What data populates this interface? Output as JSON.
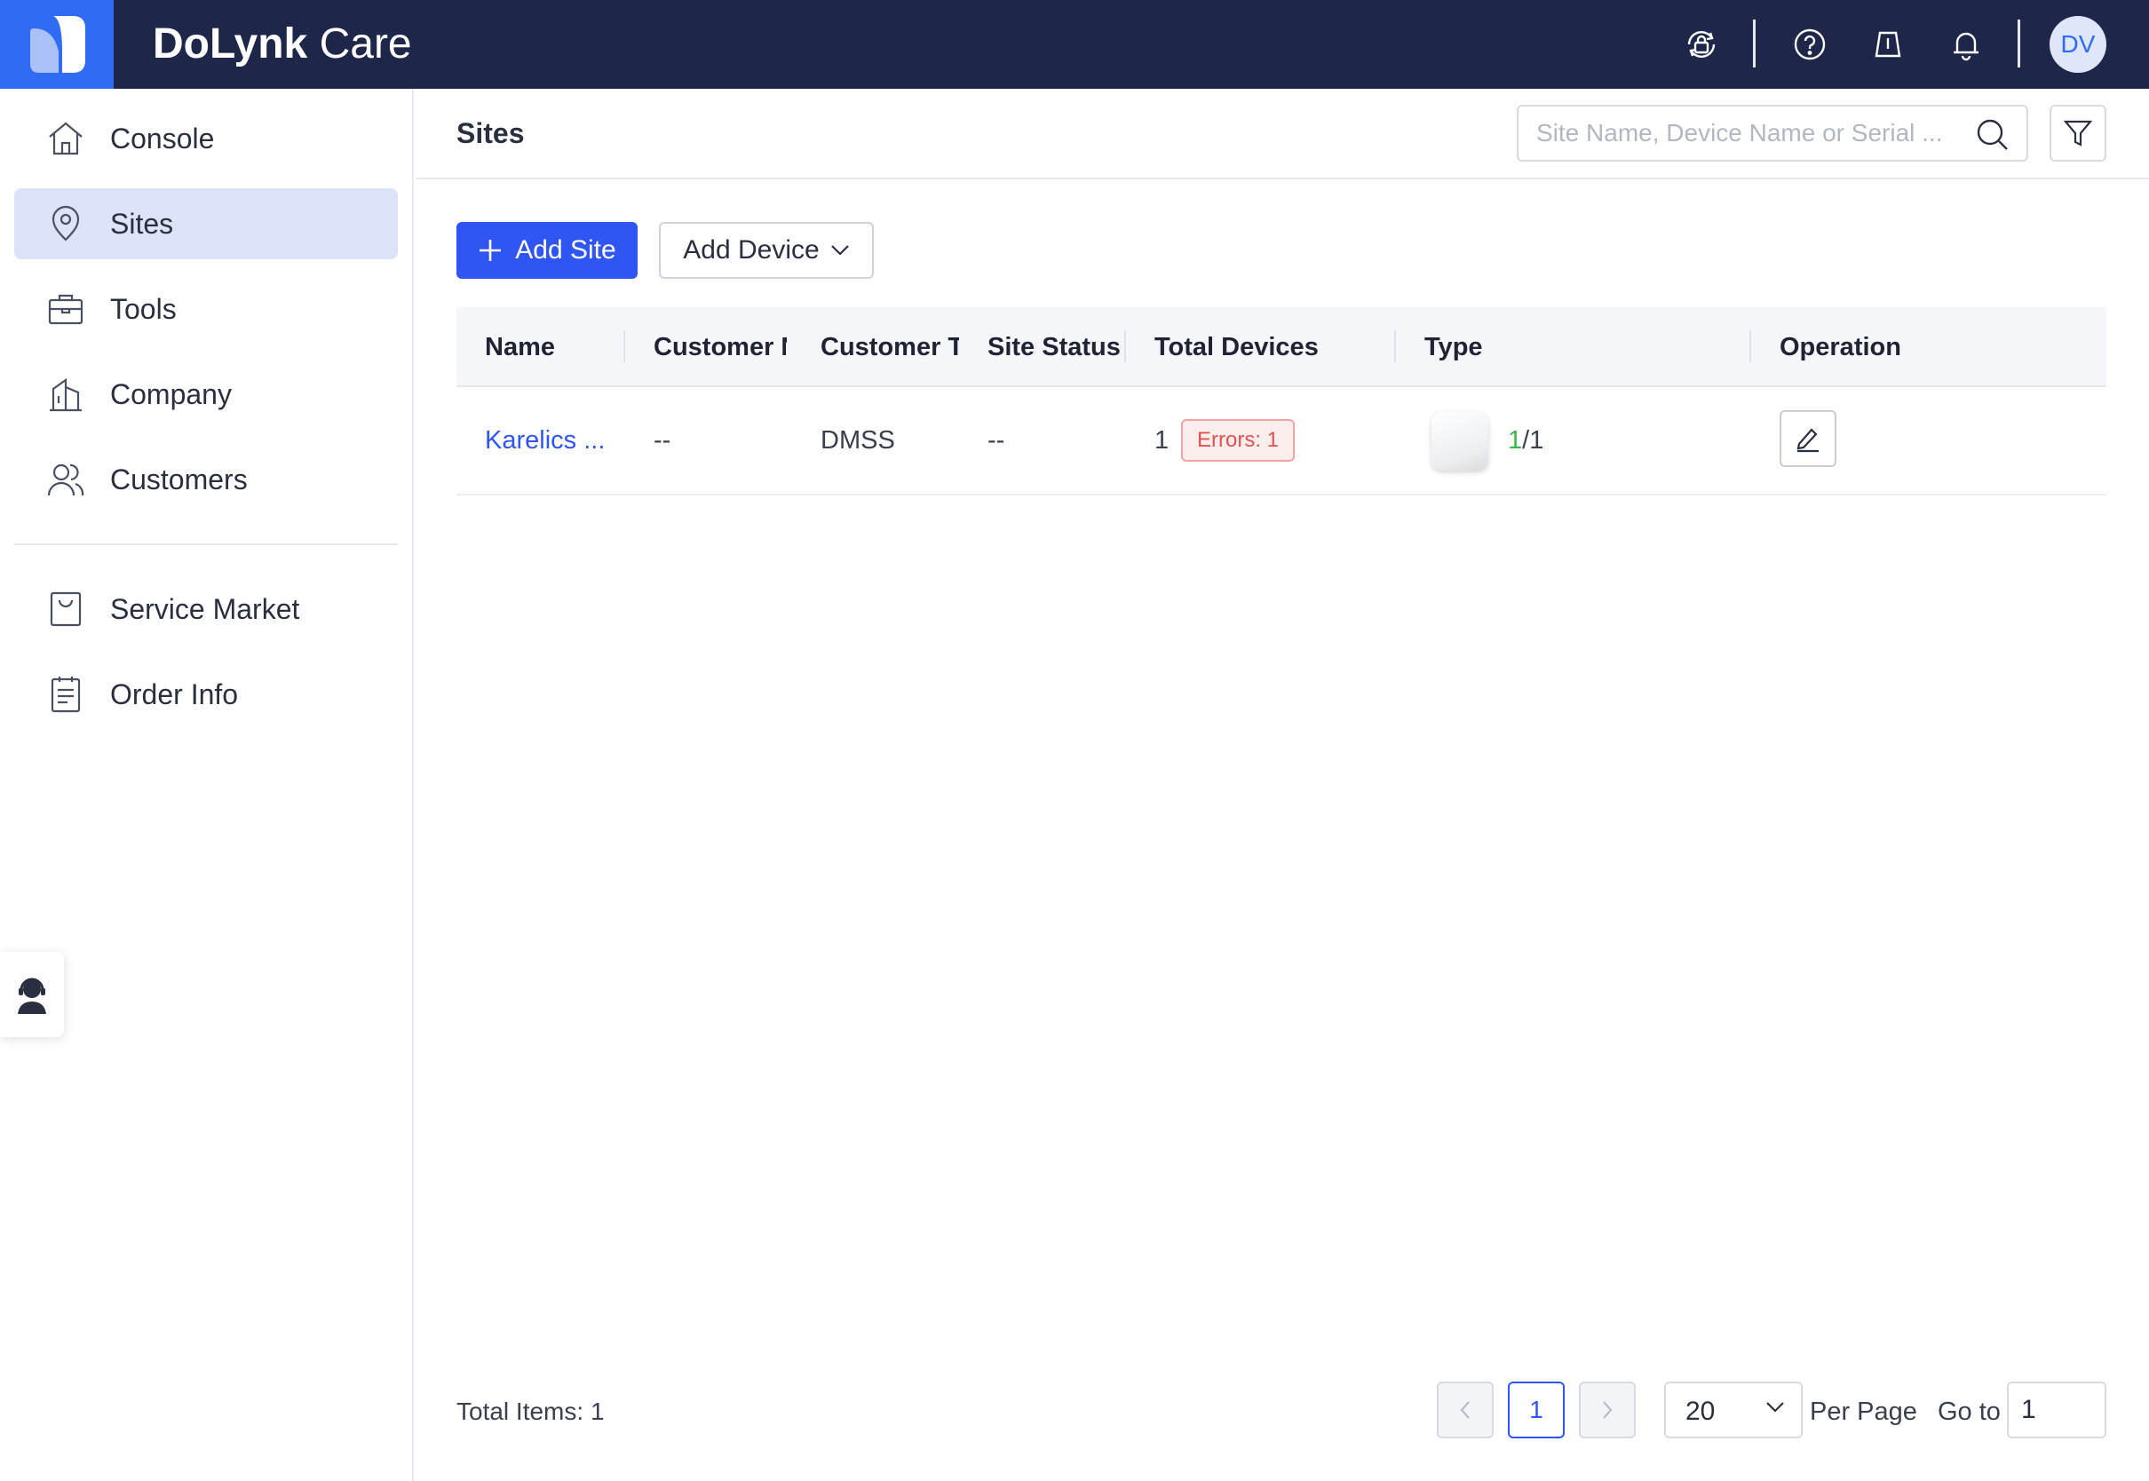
{
  "app": {
    "brand_bold": "DoLynk",
    "brand_light": "Care",
    "user_initials": "DV"
  },
  "topbar_icons": [
    "lock-sync-icon",
    "help-icon",
    "light-icon",
    "bell-icon"
  ],
  "sidebar": {
    "items": [
      {
        "label": "Console",
        "icon": "home-icon"
      },
      {
        "label": "Sites",
        "icon": "location-pin-icon",
        "active": true
      },
      {
        "label": "Tools",
        "icon": "toolbox-icon"
      },
      {
        "label": "Company",
        "icon": "building-icon"
      },
      {
        "label": "Customers",
        "icon": "users-icon"
      },
      {
        "label": "Service Market",
        "icon": "shopping-bag-icon"
      },
      {
        "label": "Order Info",
        "icon": "clipboard-icon"
      }
    ]
  },
  "header": {
    "title": "Sites",
    "search_placeholder": "Site Name, Device Name or Serial ..."
  },
  "actions": {
    "add_site": "Add Site",
    "add_device": "Add Device"
  },
  "table": {
    "columns": [
      "Name",
      "Customer Name",
      "Customer Type",
      "Site Status",
      "Total Devices",
      "Type",
      "Operation"
    ],
    "rows": [
      {
        "name": "Karelics ...",
        "customer_name": "--",
        "customer_type": "DMSS",
        "site_status": "--",
        "total_devices": "1",
        "errors_badge": "Errors: 1",
        "type_online": "1",
        "type_total": "/1"
      }
    ]
  },
  "footer": {
    "total_items": "Total Items: 1",
    "current_page": "1",
    "per_page_value": "20",
    "per_page_label": "Per Page",
    "goto_label": "Go to",
    "goto_value": "1"
  },
  "colors": {
    "topbar": "#1e2749",
    "accent": "#2f55f5",
    "active_nav": "#dde4fa",
    "error": "#e0524f",
    "online": "#3bb54a"
  }
}
